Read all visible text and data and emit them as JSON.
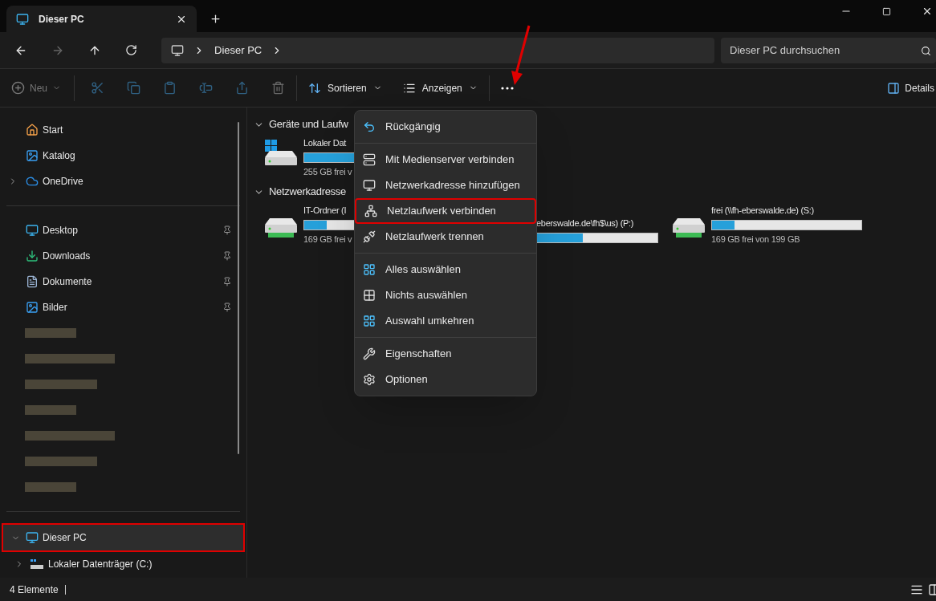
{
  "window": {
    "tab_title": "Dieser PC"
  },
  "address": {
    "crumbs": [
      "Dieser PC"
    ]
  },
  "search": {
    "placeholder": "Dieser PC durchsuchen"
  },
  "toolbar": {
    "new": {
      "label": "Neu",
      "disabled": true
    },
    "actions": [
      {
        "disabled": true
      },
      {
        "disabled": true
      },
      {
        "disabled": true
      },
      {
        "disabled": true
      },
      {
        "disabled": true
      },
      {
        "disabled": true
      }
    ],
    "sort": "Sortieren",
    "view": "Anzeigen",
    "details": "Details"
  },
  "sidebar": {
    "groups": [
      {
        "items": [
          {
            "label": "Start",
            "expandable": false
          },
          {
            "label": "Katalog",
            "expandable": false
          },
          {
            "label": "OneDrive",
            "expandable": true
          }
        ]
      },
      {
        "items": [
          {
            "label": "Desktop",
            "pinned": true
          },
          {
            "label": "Downloads",
            "pinned": true
          },
          {
            "label": "Dokumente",
            "pinned": true
          },
          {
            "label": "Bilder",
            "pinned": true
          },
          {
            "kind": "redacted"
          },
          {
            "kind": "redacted"
          },
          {
            "kind": "redacted"
          },
          {
            "kind": "redacted"
          },
          {
            "kind": "redacted"
          },
          {
            "kind": "redacted"
          },
          {
            "kind": "redacted"
          }
        ]
      },
      {
        "items": [
          {
            "label": "Dieser PC",
            "expanded": true,
            "selected": true,
            "highlighted": true,
            "children": [
              {
                "label": "Lokaler Datenträger (C:)",
                "expanded": false
              }
            ]
          }
        ]
      }
    ]
  },
  "sections": [
    {
      "title": "Geräte und Laufw",
      "expanded": true,
      "drives": [
        {
          "kind": "system",
          "name": "Lokaler Dat",
          "level": 0.6,
          "free": "255 GB frei v"
        }
      ]
    },
    {
      "title": "Netzwerkadresse",
      "expanded": true,
      "drives": [
        {
          "kind": "network",
          "name": "IT-Ordner (I",
          "level": 0.15,
          "free": "169 GB frei v"
        },
        {
          "kind": "network_covered",
          "name": "eberswalde.de\\fh$\\us) (P:)",
          "level": 0.5
        },
        {
          "kind": "network",
          "name": "frei (\\\\fh-eberswalde.de) (S:)",
          "level": 0.15,
          "free": "169 GB frei von 199 GB"
        }
      ]
    }
  ],
  "menu": {
    "groups": [
      [
        {
          "label": "Rückgängig",
          "highlighted": false
        }
      ],
      [
        {
          "label": "Mit Medienserver verbinden",
          "highlighted": false
        },
        {
          "label": "Netzwerkadresse hinzufügen",
          "highlighted": false
        },
        {
          "label": "Netzlaufwerk verbinden",
          "highlighted": true
        },
        {
          "label": "Netzlaufwerk trennen",
          "highlighted": false
        }
      ],
      [
        {
          "label": "Alles auswählen",
          "highlighted": false
        },
        {
          "label": "Nichts auswählen",
          "highlighted": false
        },
        {
          "label": "Auswahl umkehren",
          "highlighted": false
        }
      ],
      [
        {
          "label": "Eigenschaften",
          "highlighted": false
        },
        {
          "label": "Optionen",
          "highlighted": false
        }
      ]
    ]
  },
  "status_bar": {
    "count": "4 Elemente"
  }
}
